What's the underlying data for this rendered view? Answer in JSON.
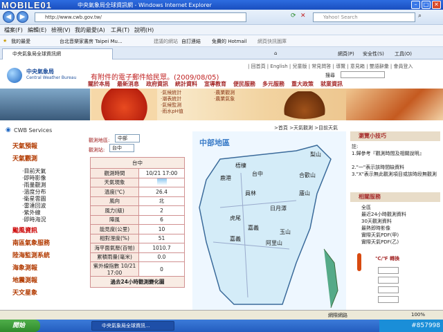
{
  "window": {
    "brand": "MOBILE01",
    "title": "中央氣象局全球資訊網 - Windows Internet Explorer"
  },
  "address": {
    "url": "http://www.cwb.gov.tw/",
    "search_placeholder": "Yahoo! Search"
  },
  "menu": [
    "檔案(F)",
    "編輯(E)",
    "檢視(V)",
    "我的最愛(A)",
    "工具(T)",
    "說明(H)"
  ],
  "favorites": [
    "我的最愛",
    "台北音樂家書房 Taipei Mu...",
    "建議的網站",
    "自訂連結",
    "免費的 Hotmail",
    "網頁快訊圖庫"
  ],
  "tab": {
    "label": "中央氣象局全球資訊網"
  },
  "ie_tools": [
    "網頁(P)",
    "安全性(S)",
    "工具(O)"
  ],
  "site": {
    "top_links": "| 回首頁 | English | 兒童版 | 常見問答 | 導覽 | 意見箱 | 雙語辭彙 | 會員登入",
    "search_label": "搜尋",
    "logo_cn": "中央氣象局",
    "logo_en": "Central Weather Bureau",
    "notice": "有附件的電子郵件給民眾。(2009/08/05)",
    "nav": [
      "關於本局",
      "最新消息",
      "政府資訊",
      "統計資料",
      "宣導教育",
      "便民服務",
      "多元服務",
      "重大政策",
      "就業資訊"
    ],
    "submenu_left": [
      "‧氣候統計",
      "‧潮表統計",
      "‧氣候監測",
      "‧雨水pH值"
    ],
    "submenu_right": [
      "‧農業觀測",
      "‧農業氣象"
    ]
  },
  "sidebar": {
    "title": "CWB Services",
    "items": [
      "天氣預報",
      "天氣觀測"
    ],
    "subs": [
      "‧目前天氣",
      "‧即時影像",
      "‧雨量觀測",
      "‧溫度分布",
      "‧衛星雲圖",
      "‧雷達回波",
      "‧紫外線",
      "‧即時海況"
    ],
    "items2": [
      "颱風資訊",
      "南區氣象服務",
      "陸海監測系統",
      "海象測報",
      "地震測報",
      "天文星象"
    ]
  },
  "selector": {
    "area_label": "觀測地區:",
    "area_value": "中部",
    "station_label": "觀測站:",
    "station_value": "台中"
  },
  "obs": {
    "station": "台中",
    "rows": [
      [
        "觀測時間",
        "10/21 17:00"
      ],
      [
        "天氣現象",
        ""
      ],
      [
        "溫度(℃)",
        "26.4"
      ],
      [
        "風向",
        "北"
      ],
      [
        "風力(級)",
        "2"
      ],
      [
        "陣風",
        "6"
      ],
      [
        "能見度(公里)",
        "10"
      ],
      [
        "相對溼度(%)",
        "51"
      ],
      [
        "海平面氣壓(百帕)",
        "1010.7"
      ],
      [
        "累積雨量(毫米)",
        "0.0"
      ],
      [
        "紫外線指數 10/21 17:00",
        "0"
      ]
    ],
    "footer": "過去24小時觀測變化圖"
  },
  "breadcrumb": ">首頁 >天氣觀測 >目前天氣",
  "map": {
    "title": "中部地區",
    "places": [
      "梨山",
      "梧棲",
      "台中",
      "鹿港",
      "合歡山",
      "員林",
      "廬山",
      "日月潭",
      "虎尾",
      "嘉義",
      "玉山",
      "阿里山",
      "嘉義"
    ]
  },
  "right": {
    "tips_title": "瀏覽小技巧",
    "tips": [
      "註:",
      "1.歸參考『觀測時間及相關說明』",
      "2.\"一\"表示該時間缺資料",
      "3.\"X\"表示無此觀測項目或該時段無觀測"
    ],
    "services_title": "相關服務",
    "services": [
      "全區",
      "最近24小時觀測資料",
      "30天觀測資料",
      "最熱即時影像",
      "實際天氣PDF(甲)",
      "實際天氣PDF(乙)"
    ],
    "convert_title": "℃/℉ 轉換"
  },
  "status": {
    "zone": "網際網路",
    "zoom": "100%"
  },
  "taskbar": {
    "start": "開始",
    "task": "中央氣象局全球資訊...",
    "watermark": "#857998"
  }
}
